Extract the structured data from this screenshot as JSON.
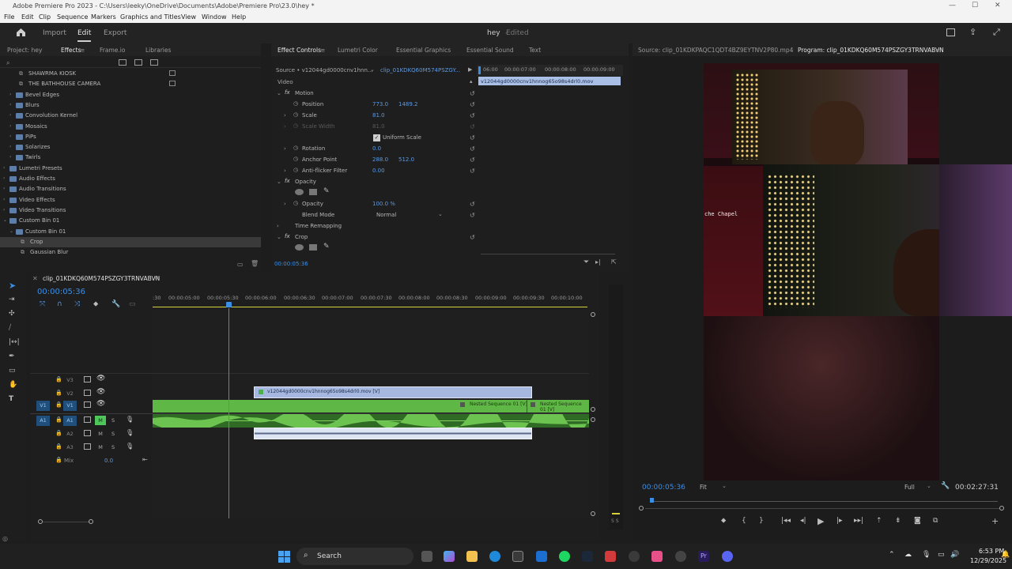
{
  "window": {
    "title": "Adobe Premiere Pro 2023 - C:\\Users\\leeky\\OneDrive\\Documents\\Adobe\\Premiere Pro\\23.0\\hey *"
  },
  "menu": [
    "File",
    "Edit",
    "Clip",
    "Sequence",
    "Markers",
    "Graphics and Titles",
    "View",
    "Window",
    "Help"
  ],
  "workspaces": {
    "home_icon": "home-icon",
    "tabs": [
      {
        "label": "Import"
      },
      {
        "label": "Edit"
      },
      {
        "label": "Export"
      }
    ],
    "project_name": "hey",
    "status": "Edited"
  },
  "left_panel": {
    "tabs": [
      "Project: hey",
      "Effects",
      "Frame.io",
      "Libraries"
    ],
    "effects_tree": [
      {
        "label": "SHAWRMA KIOSK",
        "type": "preset"
      },
      {
        "label": "THE BATHHOUSE CAMERA",
        "type": "preset"
      },
      {
        "label": "Bevel Edges",
        "type": "folder"
      },
      {
        "label": "Blurs",
        "type": "folder"
      },
      {
        "label": "Convolution Kernel",
        "type": "folder"
      },
      {
        "label": "Mosaics",
        "type": "folder"
      },
      {
        "label": "PiPs",
        "type": "folder"
      },
      {
        "label": "Solarizes",
        "type": "folder"
      },
      {
        "label": "Twirls",
        "type": "folder"
      },
      {
        "label": "Lumetri Presets",
        "type": "folder"
      },
      {
        "label": "Audio Effects",
        "type": "folder"
      },
      {
        "label": "Audio Transitions",
        "type": "folder"
      },
      {
        "label": "Video Effects",
        "type": "folder"
      },
      {
        "label": "Video Transitions",
        "type": "folder"
      },
      {
        "label": "Custom Bin 01",
        "type": "folder"
      },
      {
        "label": "Custom Bin 01",
        "type": "folder"
      },
      {
        "label": "Crop",
        "type": "effect",
        "selected": true
      },
      {
        "label": "Gaussian Blur",
        "type": "effect"
      }
    ]
  },
  "effect_controls": {
    "tabs": [
      "Effect Controls",
      "Lumetri Color",
      "Essential Graphics",
      "Essential Sound",
      "Text"
    ],
    "source": "Source • v12044gd0000cnv1hnn...",
    "clip": "clip_01KDKQ60M574PSZGY...",
    "section_video": "Video",
    "rows": {
      "motion": "Motion",
      "position_label": "Position",
      "position_x": "773.0",
      "position_y": "1489.2",
      "scale_label": "Scale",
      "scale_val": "81.0",
      "scale_width_label": "Scale Width",
      "scale_width_val": "81.0",
      "uniform_scale": "Uniform Scale",
      "rotation_label": "Rotation",
      "rotation_val": "0.0",
      "anchor_label": "Anchor Point",
      "anchor_x": "288.0",
      "anchor_y": "512.0",
      "antiflicker_label": "Anti-flicker Filter",
      "antiflicker_val": "0.00",
      "opacity_section": "Opacity",
      "opacity_label": "Opacity",
      "opacity_val": "100.0 %",
      "blend_label": "Blend Mode",
      "blend_val": "Normal",
      "time_remap": "Time Remapping",
      "crop": "Crop"
    },
    "timecode": "00:00:05:36",
    "mini_ruler": [
      "06:00",
      "00:00:07:00",
      "00:00:08:00",
      "00:00:09:00"
    ],
    "mini_clip": "v12044gd0000cnv1hnnog65o98s4drl0.mov"
  },
  "source_monitor": {
    "source_tab": "Source: clip_01KDKPAQC1QDT4BZ9EYTNV2P80.mp4",
    "program_tab": "Program: clip_01KDKQ60M574PSZGY3TRNVABVN",
    "overlay_text": "che Chapel",
    "timecode": "00:00:05:36",
    "fit": "Fit",
    "quality": "Full",
    "duration": "00:02:27:31"
  },
  "timeline": {
    "sequence_name": "clip_01KDKQ60M574PSZGY3TRNVABVN",
    "timecode": "00:00:05:36",
    "ruler": [
      ":30",
      "00:00:05:00",
      "00:00:05:30",
      "00:00:06:00",
      "00:00:06:30",
      "00:00:07:00",
      "00:00:07:30",
      "00:00:08:00",
      "00:00:08:30",
      "00:00:09:00",
      "00:00:09:30",
      "00:00:10:00"
    ],
    "tracks": [
      {
        "name": "V3",
        "kind": "video"
      },
      {
        "name": "V2",
        "kind": "video"
      },
      {
        "name": "V1",
        "kind": "video",
        "src": "V1"
      },
      {
        "name": "A1",
        "kind": "audio",
        "src": "A1"
      },
      {
        "name": "A2",
        "kind": "audio"
      },
      {
        "name": "A3",
        "kind": "audio"
      }
    ],
    "mix_label": "Mix",
    "mix_value": "0.0",
    "clip_v2": "v12044gd0000cnv1hnnog65o98s4drl0.mov [V]",
    "nested1": "Nested Sequence 01 [V]",
    "nested2": "Nested Sequence 01 [V]",
    "meter_label": "S S"
  },
  "taskbar": {
    "search": "Search",
    "time": "6:53 PM",
    "date": "12/29/2025"
  },
  "colors": {
    "accent_blue": "#3b8ee6",
    "clip_green": "#5fb745",
    "clip_lavender": "#a7b8e0"
  }
}
